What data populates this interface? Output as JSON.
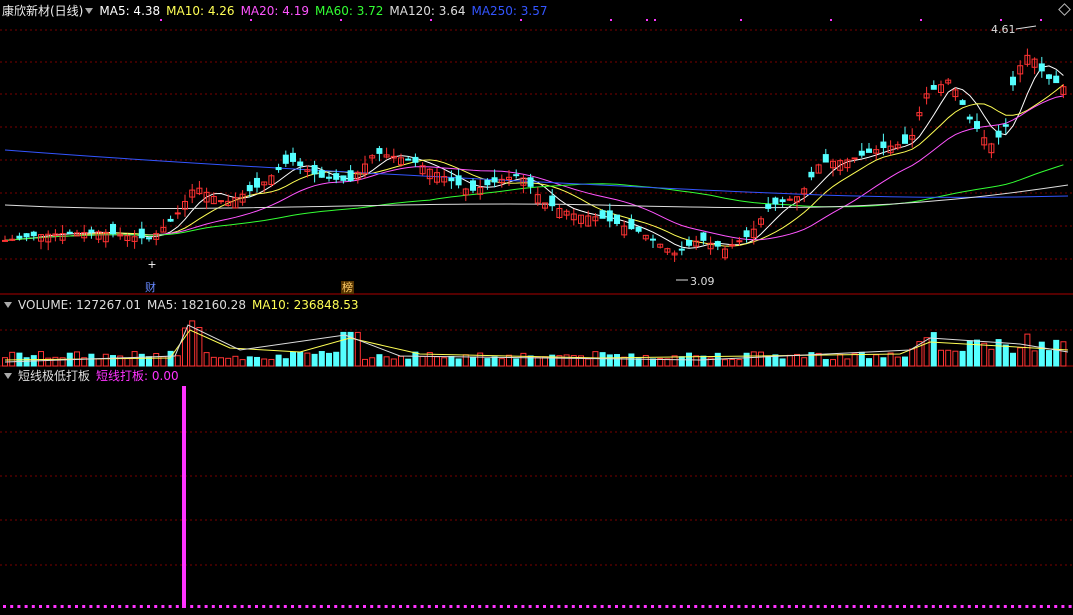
{
  "stock": {
    "title": "康欣新材(日线)"
  },
  "ma_legend": [
    {
      "text": "MA5: 4.38",
      "color": "#ffffff"
    },
    {
      "text": "MA10: 4.26",
      "color": "#ffff55"
    },
    {
      "text": "MA20: 4.19",
      "color": "#ff55ff"
    },
    {
      "text": "MA60: 3.72",
      "color": "#33ff33"
    },
    {
      "text": "MA120: 3.64",
      "color": "#dddddd"
    },
    {
      "text": "MA250: 3.57",
      "color": "#3355ff"
    }
  ],
  "volume_legend": [
    {
      "text": "VOLUME: 127267.01",
      "color": "#dddddd"
    },
    {
      "text": "MA5: 182160.28",
      "color": "#dddddd"
    },
    {
      "text": "MA10: 236848.53",
      "color": "#ffff55"
    }
  ],
  "indicator": {
    "name": "短线极低打板",
    "series_label": "短线打板: 0.00",
    "series_color": "#ff33ff"
  },
  "annotations": {
    "high_label": "4.61",
    "low_label": "3.09",
    "event_cai": "财",
    "event_bang": "榜"
  },
  "colors": {
    "up": "#ff3333",
    "down": "#55ffff",
    "grid": "#7a0000",
    "panel_border": "#aa0000",
    "bg": "#000000"
  },
  "chart_data": {
    "type": "candlestick",
    "price_range": [
      3.0,
      4.7
    ],
    "high": 4.61,
    "low": 3.09
  }
}
